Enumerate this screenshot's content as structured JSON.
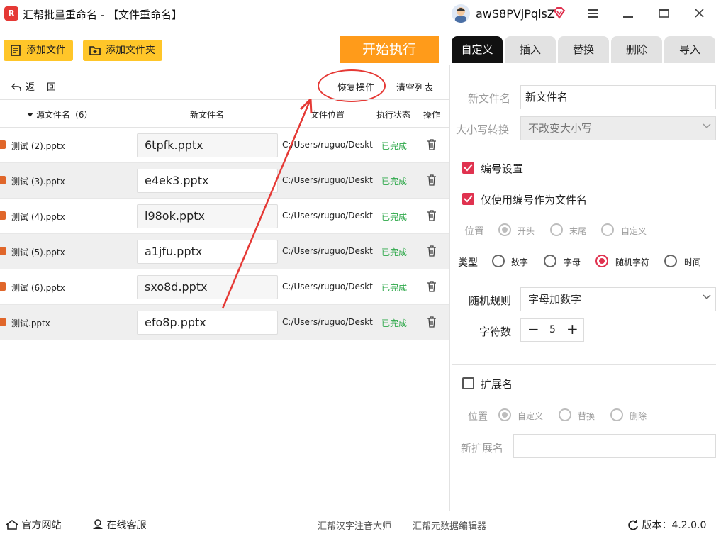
{
  "window": {
    "title": "汇帮批量重命名 - 【文件重命名】",
    "user": "awS8PVjPqlsZ",
    "logo": "R"
  },
  "toolbar": {
    "add_file": "添加文件",
    "add_folder": "添加文件夹",
    "start": "开始执行",
    "back": "返",
    "redo": "回",
    "restore": "恢复操作",
    "clear": "清空列表"
  },
  "tabs": [
    "自定义",
    "插入",
    "替换",
    "删除",
    "导入"
  ],
  "table": {
    "headers": {
      "source": "源文件名（6）",
      "new": "新文件名",
      "path": "文件位置",
      "status": "执行状态",
      "action": "操作"
    },
    "rows": [
      {
        "source": "测试 (2).pptx",
        "new": "6tpfk.pptx",
        "path": "C:/Users/ruguo/Desktop",
        "status": "已完成"
      },
      {
        "source": "测试 (3).pptx",
        "new": "e4ek3.pptx",
        "path": "C:/Users/ruguo/Desktop",
        "status": "已完成"
      },
      {
        "source": "测试 (4).pptx",
        "new": "l98ok.pptx",
        "path": "C:/Users/ruguo/Desktop",
        "status": "已完成"
      },
      {
        "source": "测试 (5).pptx",
        "new": "a1jfu.pptx",
        "path": "C:/Users/ruguo/Desktop",
        "status": "已完成"
      },
      {
        "source": "测试 (6).pptx",
        "new": "sxo8d.pptx",
        "path": "C:/Users/ruguo/Desktop",
        "status": "已完成"
      },
      {
        "source": "测试.pptx",
        "new": "efo8p.pptx",
        "path": "C:/Users/ruguo/Desktop",
        "status": "已完成"
      }
    ]
  },
  "panel": {
    "new_name_label": "新文件名",
    "new_name_value": "新文件名",
    "case_label": "大小写转换",
    "case_value": "不改变大小写",
    "numbering": "编号设置",
    "use_number_only": "仅使用编号作为文件名",
    "position_label": "位置",
    "position_options": [
      "开头",
      "末尾",
      "自定义"
    ],
    "type_label": "类型",
    "type_options": [
      "数字",
      "字母",
      "随机字符",
      "时间"
    ],
    "random_rule_label": "随机规则",
    "random_rule_value": "字母加数字",
    "char_count_label": "字符数",
    "char_count_value": "5",
    "extension": "扩展名",
    "ext_position_label": "位置",
    "ext_position_options": [
      "自定义",
      "替换",
      "删除"
    ],
    "new_ext_label": "新扩展名",
    "new_ext_value": ""
  },
  "footer": {
    "website": "官方网站",
    "service": "在线客服",
    "tool1": "汇帮汉字注音大师",
    "tool2": "汇帮元数据编辑器",
    "version": "版本：4.2.0.0"
  },
  "colors": {
    "accent_red": "#e0324f",
    "yellow": "#ffc629",
    "orange": "#ff9b1a",
    "status_green": "#2ea84a"
  }
}
